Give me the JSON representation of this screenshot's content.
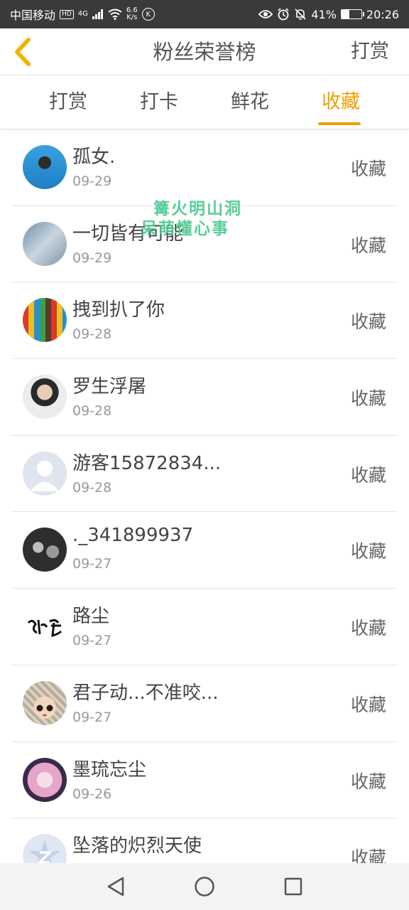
{
  "status_bar": {
    "carrier": "中国移动",
    "hd_badge": "HD",
    "network": "4G",
    "speed_value": "6.6",
    "speed_unit": "K/s",
    "k_icon_label": "K",
    "battery_percent": "41%",
    "battery_level": 0.41,
    "time": "20:26"
  },
  "header": {
    "title": "粉丝荣誉榜",
    "action_label": "打赏"
  },
  "tabs": [
    {
      "label": "打赏",
      "active": false
    },
    {
      "label": "打卡",
      "active": false
    },
    {
      "label": "鲜花",
      "active": false
    },
    {
      "label": "收藏",
      "active": true
    }
  ],
  "accent_color": "#f0a000",
  "users": [
    {
      "name": "孤女.",
      "date": "09-29",
      "action": "收藏"
    },
    {
      "name": "一切皆有可能",
      "date": "09-29",
      "action": "收藏"
    },
    {
      "name": "拽到扒了你",
      "date": "09-28",
      "action": "收藏"
    },
    {
      "name": "罗生浮屠",
      "date": "09-28",
      "action": "收藏"
    },
    {
      "name": "游客15872834...",
      "date": "09-28",
      "action": "收藏"
    },
    {
      "name": "._341899937",
      "date": "09-27",
      "action": "收藏"
    },
    {
      "name": "路尘",
      "date": "09-27",
      "action": "收藏"
    },
    {
      "name": "君子动...不准咬...",
      "date": "09-27",
      "action": "收藏"
    },
    {
      "name": "墨琉忘尘",
      "date": "09-26",
      "action": "收藏"
    },
    {
      "name": "坠落的炽烈天使",
      "date": "",
      "action": "收藏"
    }
  ],
  "watermark": {
    "line1": "篝火明山洞",
    "line2": "呆萌懂心事"
  }
}
